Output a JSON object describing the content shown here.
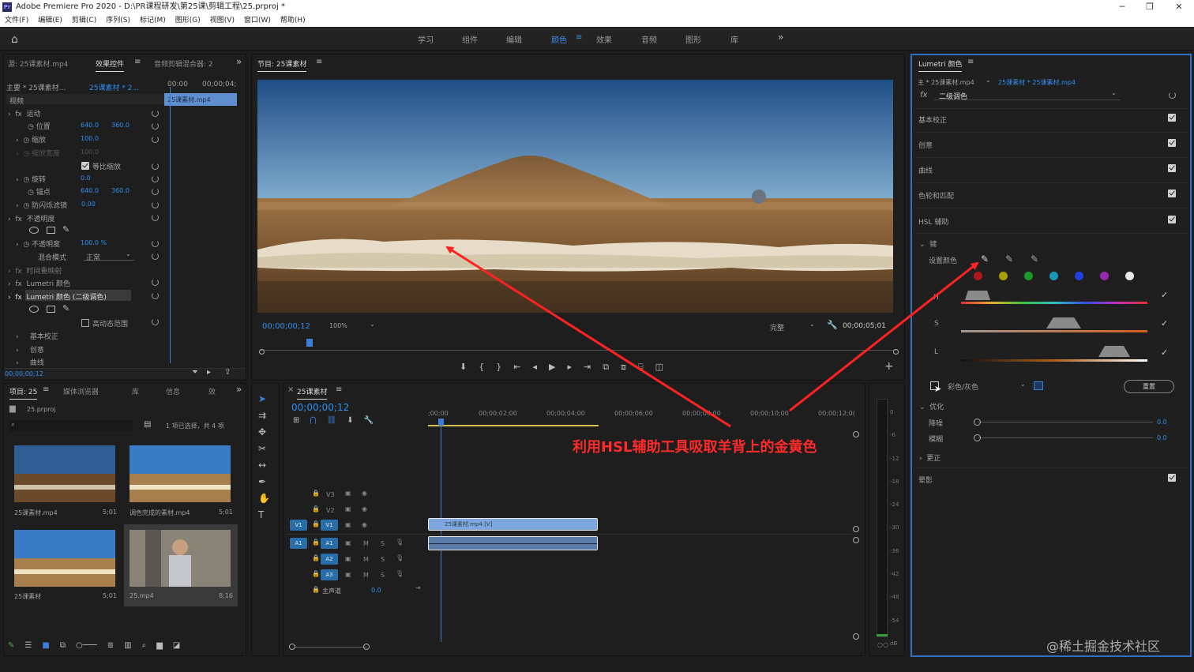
{
  "window": {
    "title": "Adobe Premiere Pro 2020 - D:\\PR课程研发\\第25课\\剪辑工程\\25.prproj *"
  },
  "menu": [
    "文件(F)",
    "编辑(E)",
    "剪辑(C)",
    "序列(S)",
    "标记(M)",
    "图形(G)",
    "视图(V)",
    "窗口(W)",
    "帮助(H)"
  ],
  "workspaces": [
    "学习",
    "组件",
    "编辑",
    "颜色",
    "效果",
    "音频",
    "图形",
    "库"
  ],
  "workspace_active": "颜色",
  "source_panel": {
    "tabs": [
      "源: 25课素材.mp4",
      "效果控件",
      "音频剪辑混合器: 2"
    ],
    "header_master": "主要 * 25课素材...",
    "header_clip": "25课素材 * 2...",
    "time_start": "00:00",
    "time_end": "00;00;04;",
    "clip_label": "25课素材.mp4",
    "section_video": "视频",
    "motion": "运动",
    "position_label": "位置",
    "position_x": "640.0",
    "position_y": "360.0",
    "scale_label": "缩放",
    "scale_val": "100.0",
    "scale_width_label": "缩放宽度",
    "scale_width_val": "100.0",
    "uniform_scale": "等比缩放",
    "rotation_label": "旋转",
    "rotation_val": "0.0",
    "anchor_label": "锚点",
    "anchor_x": "640.0",
    "anchor_y": "360.0",
    "flicker_label": "防闪烁滤镜",
    "flicker_val": "0.00",
    "opacity": "不透明度",
    "opacity_label": "不透明度",
    "opacity_val": "100.0 %",
    "blend_label": "混合模式",
    "blend_val": "正常",
    "time_remap": "时间重映射",
    "lumetri1": "Lumetri 颜色",
    "lumetri2": "Lumetri 颜色 (二级调色)",
    "hdr": "高动态范围",
    "basic": "基本校正",
    "creative": "创意",
    "curves": "曲线",
    "timecode": "00;00;00;12"
  },
  "program": {
    "tab": "节目: 25课素材",
    "timecode": "00;00;00;12",
    "zoom": "100%",
    "quality": "完整",
    "duration": "00;00;05;01"
  },
  "project": {
    "tabs": [
      "项目: 25",
      "媒体浏览器",
      "库",
      "信息",
      "效"
    ],
    "file": "25.prproj",
    "selection": "1 项已选择，共 4 项",
    "items": [
      {
        "name": "25课素材.mp4",
        "dur": "5;01"
      },
      {
        "name": "调色完成的素材.mp4",
        "dur": "5;01"
      },
      {
        "name": "25课素材",
        "dur": "5;01"
      },
      {
        "name": "25.mp4",
        "dur": "8;16"
      }
    ]
  },
  "timeline": {
    "tab": "25课素材",
    "timecode": "00;00;00;12",
    "ruler": [
      ";00;00",
      "00;00;02;00",
      "00;00;04;00",
      "00;00;06;00",
      "00;00;08;00",
      "00;00;10;00",
      "00;00;12;0("
    ],
    "video_tracks": [
      "V3",
      "V2",
      "V1"
    ],
    "audio_tracks": [
      "A1",
      "A2",
      "A3"
    ],
    "src_v": "V1",
    "src_a": "A1",
    "master": "主声道",
    "master_val": "0.0",
    "clip_label": "25课素材.mp4 [V]",
    "mute": "M",
    "solo": "S"
  },
  "meter": {
    "scale": [
      "0",
      "-6",
      "-12",
      "-18",
      "-24",
      "-30",
      "-36",
      "-42",
      "-48",
      "-54",
      "dB"
    ]
  },
  "lumetri": {
    "tab": "Lumetri 颜色",
    "master": "主 * 25课素材.mp4",
    "clip": "25课素材 * 25课素材.mp4",
    "preset": "二级调色",
    "sections": [
      "基本校正",
      "创意",
      "曲线",
      "色轮和匹配",
      "HSL 辅助"
    ],
    "key": "键",
    "set_color": "设置颜色",
    "h": "H",
    "s": "S",
    "l": "L",
    "color_gray": "彩色/灰色",
    "reset": "重置",
    "refine": "优化",
    "denoise": "降噪",
    "denoise_val": "0.0",
    "blur": "模糊",
    "blur_val": "0.0",
    "correction": "更正",
    "vignette": "晕影",
    "swatches": [
      "#b01818",
      "#a8a000",
      "#1a9a2a",
      "#1898b8",
      "#2040e0",
      "#9828b0",
      "#e8e8e8"
    ]
  },
  "annotation": "利用HSL辅助工具吸取羊背上的金黄色",
  "watermark": "@稀土掘金技术社区"
}
